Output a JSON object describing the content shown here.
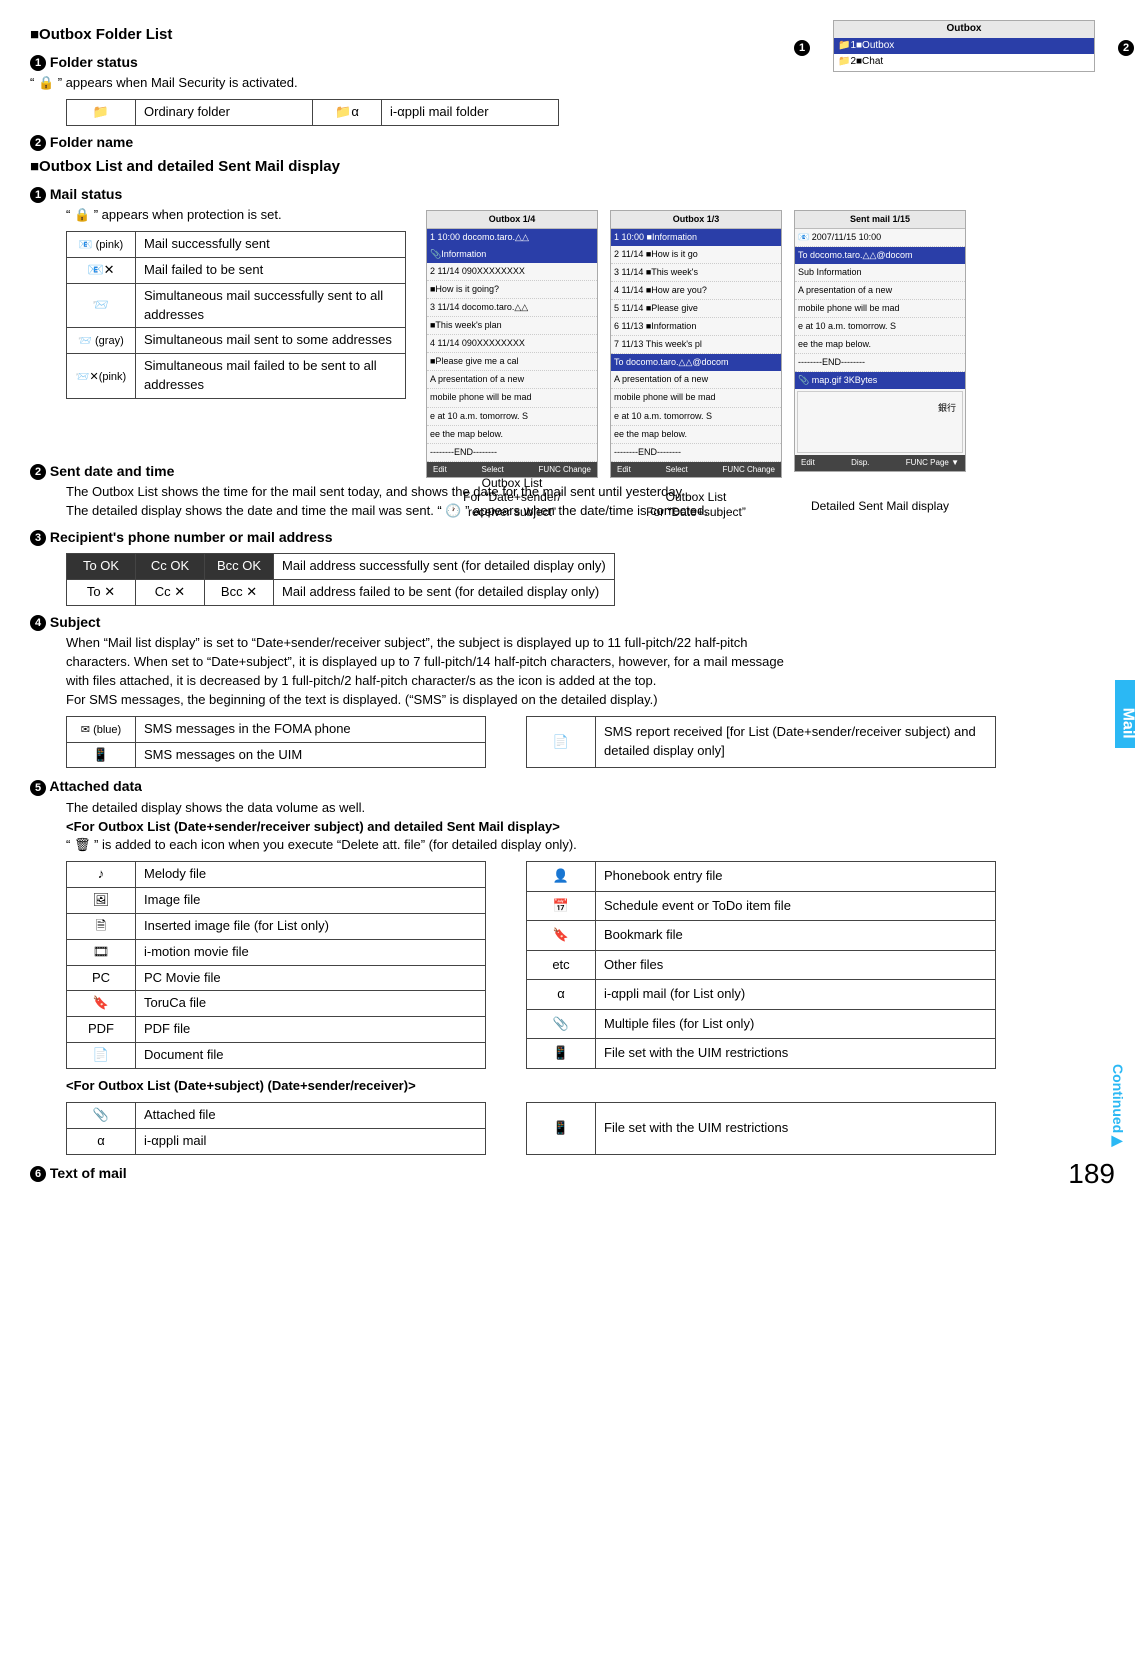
{
  "page_number": "189",
  "side_tab": "Mail",
  "continued": "Continued▶",
  "sec_outbox_folder": "■Outbox Folder List",
  "h_folder_status_num": "1",
  "h_folder_status": "Folder status",
  "folder_status_desc": "“ 🔒 ” appears when Mail Security is activated.",
  "folder_status_table": {
    "r1c1_icon": "📁",
    "r1c2": "Ordinary folder",
    "r1c3_icon": "📁α",
    "r1c4": "i-αppli mail folder"
  },
  "h_folder_name_num": "2",
  "h_folder_name": "Folder name",
  "top_fig": {
    "title": "Outbox",
    "row1": "📁1■Outbox",
    "row2": "📁2■Chat",
    "bullet_left": "1",
    "bullet_right": "2"
  },
  "sec_outbox_list": "■Outbox List and detailed Sent Mail display",
  "h_mail_status_num": "1",
  "h_mail_status": "Mail status",
  "mail_status_desc": "“ 🔒 ” appears when protection is set.",
  "mail_status_table": {
    "r1icon": "📧 (pink)",
    "r1txt": "Mail successfully sent",
    "r2icon": "📧✕",
    "r2txt": "Mail failed to be sent",
    "r3icon": "📨",
    "r3txt": "Simultaneous mail successfully sent to all addresses",
    "r4icon": "📨 (gray)",
    "r4txt": "Simultaneous mail sent to some addresses",
    "r5icon": "📨✕(pink)",
    "r5txt": "Simultaneous mail failed to be sent to all addresses"
  },
  "fig1": {
    "title": "Outbox     1/4",
    "row_hl": "1 10:00 docomo.taro.△△",
    "row_hl2": "   📎Information",
    "row2": "2 11/14 090XXXXXXXX",
    "row2b": "   ■How is it going?",
    "row3": "3 11/14 docomo.taro.△△",
    "row3b": "   ■This week's plan",
    "row4": "4 11/14 090XXXXXXXX",
    "row4b": "   ■Please give me a cal",
    "preview1": "A presentation of a new",
    "preview2": "mobile phone will be mad",
    "preview3": "e at 10 a.m. tomorrow. S",
    "preview4": "ee the map below.",
    "preview5": "--------END--------",
    "sk_l": "Edit",
    "sk_c": "Select",
    "sk_r": "FUNC\nChange",
    "caption1": "Outbox List",
    "caption2": "For “Date+sender/",
    "caption3": "receiver subject”"
  },
  "fig2": {
    "title": "Outbox     1/3",
    "row_hl": "1 10:00   ■Information",
    "row2": "2 11/14   ■How is it go",
    "row3": "3 11/14   ■This week's",
    "row4": "4 11/14   ■How are you?",
    "row5": "5 11/14   ■Please give",
    "row6": "6 11/13   ■Information",
    "row7": "7 11/13   This week's pl",
    "row_to": "To docomo.taro.△△@docom",
    "preview1": "A presentation of a new",
    "preview2": "mobile phone will be mad",
    "preview3": "e at 10 a.m. tomorrow. S",
    "preview4": "ee the map below.",
    "preview5": "--------END--------",
    "sk_l": "Edit",
    "sk_c": "Select",
    "sk_r": "FUNC\nChange",
    "caption1": "Outbox List",
    "caption2": "For “Date+subject”"
  },
  "fig3": {
    "title": "Sent mail   1/15",
    "row1": "📧 2007/11/15 10:00",
    "row2": "To docomo.taro.△△@docom",
    "row3": "Sub Information",
    "preview1": "A presentation of a new",
    "preview2": "mobile phone will be mad",
    "preview3": "e at 10 a.m. tomorrow. S",
    "preview4": "ee the map below.",
    "preview5": "--------END--------",
    "att": "📎 map.gif        3KBytes",
    "map_label": "銀行",
    "sk_l": "Edit",
    "sk_c": "Disp.",
    "sk_r": "FUNC\nPage ▼",
    "caption1": "Detailed Sent Mail display"
  },
  "h_sent_date_num": "2",
  "h_sent_date": "Sent date and time",
  "sent_date_desc1": "The Outbox List shows the time for the mail sent today, and shows the date for the mail sent until yesterday.",
  "sent_date_desc2": "The detailed display shows the date and time the mail was sent. “ 🕐 ” appears when the date/time is corrected.",
  "h_recipient_num": "3",
  "h_recipient": "Recipient's phone number or mail address",
  "recipient_table": {
    "r1c1": "To OK",
    "r1c2": "Cc OK",
    "r1c3": "Bcc OK",
    "r1txt": "Mail address successfully sent (for detailed display only)",
    "r2c1": "To ✕",
    "r2c2": "Cc ✕",
    "r2c3": "Bcc ✕",
    "r2txt": "Mail address failed to be sent (for detailed display only)"
  },
  "h_subject_num": "4",
  "h_subject": "Subject",
  "subject_desc1": "When “Mail list display” is set to “Date+sender/receiver subject”, the subject is displayed up to 11 full-pitch/22 half-pitch",
  "subject_desc2": "characters. When set to “Date+subject”, it is displayed up to 7 full-pitch/14 half-pitch characters, however, for a mail message",
  "subject_desc3": "with files attached, it is decreased by 1 full-pitch/2 half-pitch character/s as the icon is added at the top.",
  "subject_desc4": "For SMS messages, the beginning of the text is displayed. (“SMS” is displayed on the detailed display.)",
  "subject_table_left": {
    "r1icon": "✉ (blue)",
    "r1txt": "SMS messages in the FOMA phone",
    "r2icon": "📱",
    "r2txt": "SMS messages on the UIM"
  },
  "subject_table_right": {
    "r1icon": "📄",
    "r1txt": "SMS report received [for List (Date+sender/receiver subject) and detailed display only]"
  },
  "h_attached_num": "5",
  "h_attached": "Attached data",
  "attached_desc1": "The detailed display shows the data volume as well.",
  "attached_desc2": "<For Outbox List (Date+sender/receiver subject) and detailed Sent Mail display>",
  "attached_desc3": "“ 🗑 ” is added to each icon when you execute “Delete att. file” (for detailed display only).",
  "att_table_left": {
    "r1icon": "♪",
    "r1txt": "Melody file",
    "r2icon": "🖼",
    "r2txt": "Image file",
    "r3icon": "🗎",
    "r3txt": "Inserted image file (for List only)",
    "r4icon": "🎞",
    "r4txt": "i-motion movie file",
    "r5icon": "PC",
    "r5txt": "PC Movie file",
    "r6icon": "🔖",
    "r6txt": "ToruCa file",
    "r7icon": "PDF",
    "r7txt": "PDF file",
    "r8icon": "📄",
    "r8txt": "Document file"
  },
  "att_table_right": {
    "r1icon": "👤",
    "r1txt": "Phonebook entry file",
    "r2icon": "📅",
    "r2txt": "Schedule event or ToDo item file",
    "r3icon": "🔖",
    "r3txt": "Bookmark file",
    "r4icon": "etc",
    "r4txt": "Other files",
    "r5icon": "α",
    "r5txt": "i-αppli mail (for List only)",
    "r6icon": "📎",
    "r6txt": "Multiple files (for List only)",
    "r7icon": "📱",
    "r7txt": "File set with the UIM restrictions"
  },
  "attached_desc4": "<For Outbox List (Date+subject) (Date+sender/receiver)>",
  "att2_table_left": {
    "r1icon": "📎",
    "r1txt": "Attached file",
    "r2icon": "α",
    "r2txt": "i-αppli mail"
  },
  "att2_table_right": {
    "r1icon": "📱",
    "r1txt": "File set with the UIM restrictions"
  },
  "h_textmail_num": "6",
  "h_textmail": "Text of mail"
}
